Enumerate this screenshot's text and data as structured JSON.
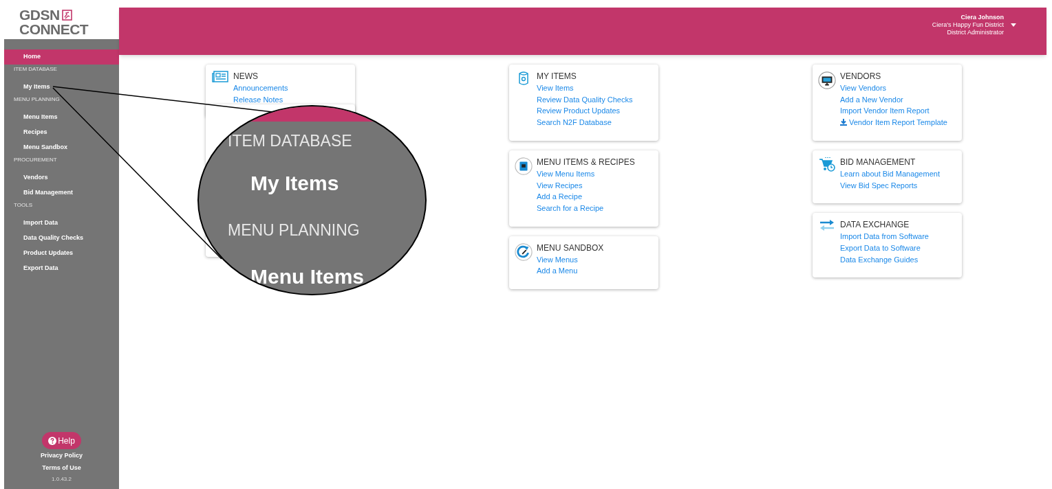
{
  "logo": {
    "line1": "GDSN",
    "line2": "CONNECT"
  },
  "sidebar": {
    "items": [
      {
        "kind": "link",
        "label": "Home",
        "selected": true
      },
      {
        "kind": "section",
        "label": "ITEM DATABASE"
      },
      {
        "kind": "link",
        "label": "My Items",
        "selected": false
      },
      {
        "kind": "section",
        "label": "MENU PLANNING"
      },
      {
        "kind": "link",
        "label": "Menu Items",
        "selected": false
      },
      {
        "kind": "link",
        "label": "Recipes",
        "selected": false
      },
      {
        "kind": "link",
        "label": "Menu Sandbox",
        "selected": false
      },
      {
        "kind": "section",
        "label": "PROCUREMENT"
      },
      {
        "kind": "link",
        "label": "Vendors",
        "selected": false
      },
      {
        "kind": "link",
        "label": "Bid Management",
        "selected": false
      },
      {
        "kind": "section",
        "label": "TOOLS"
      },
      {
        "kind": "link",
        "label": "Import Data",
        "selected": false
      },
      {
        "kind": "link",
        "label": "Data Quality Checks",
        "selected": false
      },
      {
        "kind": "link",
        "label": "Product Updates",
        "selected": false
      },
      {
        "kind": "link",
        "label": "Export Data",
        "selected": false
      }
    ],
    "help": "Help",
    "links": [
      "Privacy Policy",
      "Terms of Use"
    ],
    "version": "1.0.43.2"
  },
  "header": {
    "user_name": "Ciera Johnson",
    "district": "Ciera's Happy Fun District",
    "role": "District Administrator"
  },
  "columns": [
    [
      {
        "kind": "news",
        "title": "NEWS",
        "links": [
          {
            "text": "Announcements",
            "download": false
          },
          {
            "text": "Release Notes",
            "download": false
          }
        ]
      },
      {
        "kind": "covered"
      }
    ],
    [
      {
        "kind": "can",
        "title": "MY ITEMS",
        "links": [
          {
            "text": "View Items",
            "download": false
          },
          {
            "text": "Review Data Quality Checks",
            "download": false
          },
          {
            "text": "Review Product Updates",
            "download": false
          },
          {
            "text": "Search N2F Database",
            "download": false
          }
        ]
      },
      {
        "kind": "book",
        "title": "MENU ITEMS & RECIPES",
        "links": [
          {
            "text": "View Menu Items",
            "download": false
          },
          {
            "text": "View Recipes",
            "download": false
          },
          {
            "text": "Add a Recipe",
            "download": false
          },
          {
            "text": "Search for a Recipe",
            "download": false
          }
        ]
      },
      {
        "kind": "sandbox",
        "title": "MENU SANDBOX",
        "links": [
          {
            "text": "View Menus",
            "download": false
          },
          {
            "text": "Add a Menu",
            "download": false
          }
        ]
      }
    ],
    [
      {
        "kind": "monitor",
        "title": "VENDORS",
        "links": [
          {
            "text": "View Vendors",
            "download": false
          },
          {
            "text": "Add a New Vendor",
            "download": false
          },
          {
            "text": "Import Vendor Item Report",
            "download": false
          },
          {
            "text": "Vendor Item Report Template",
            "download": true
          }
        ]
      },
      {
        "kind": "cart",
        "title": "BID MANAGEMENT",
        "links": [
          {
            "text": "Learn about Bid Management",
            "download": false
          },
          {
            "text": "View Bid Spec Reports",
            "download": false
          }
        ]
      },
      {
        "kind": "exchange",
        "title": "DATA EXCHANGE",
        "links": [
          {
            "text": "Import Data from Software",
            "download": false
          },
          {
            "text": "Export Data to Software",
            "download": false
          },
          {
            "text": "Data Exchange Guides",
            "download": false
          }
        ]
      }
    ]
  ],
  "magnifier": {
    "lines": [
      {
        "kind": "section",
        "text": "ITEM DATABASE"
      },
      {
        "kind": "link",
        "text": "My Items"
      },
      {
        "kind": "section",
        "text": "MENU PLANNING"
      },
      {
        "kind": "link",
        "text": "Menu Items"
      }
    ]
  }
}
